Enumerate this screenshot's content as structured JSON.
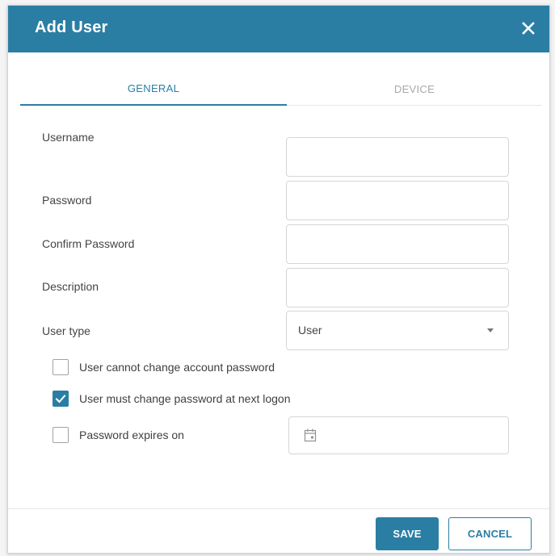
{
  "dialog": {
    "title": "Add User",
    "close_icon": "close-icon"
  },
  "tabs": [
    {
      "label": "GENERAL",
      "active": true
    },
    {
      "label": "DEVICE",
      "active": false
    }
  ],
  "form": {
    "username": {
      "label": "Username",
      "value": ""
    },
    "password": {
      "label": "Password",
      "value": ""
    },
    "confirm_password": {
      "label": "Confirm Password",
      "value": ""
    },
    "description": {
      "label": "Description",
      "value": ""
    },
    "user_type": {
      "label": "User type",
      "value": "User"
    }
  },
  "checkboxes": [
    {
      "label": "User cannot change account password",
      "checked": false
    },
    {
      "label": "User must change password at next logon",
      "checked": true
    },
    {
      "label": "Password expires on",
      "checked": false
    }
  ],
  "date_field": {
    "icon": "calendar-icon",
    "value": ""
  },
  "buttons": {
    "save": "SAVE",
    "cancel": "CANCEL"
  },
  "colors": {
    "primary": "#2b7ea3",
    "header_bg": "#2b7ea3"
  }
}
